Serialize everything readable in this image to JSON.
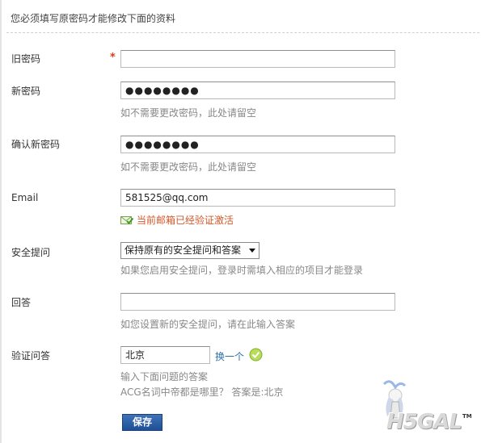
{
  "header": {
    "title": "您必须填写原密码才能修改下面的资料"
  },
  "form": {
    "old_password": {
      "label": "旧密码",
      "required_mark": "*",
      "value": ""
    },
    "new_password": {
      "label": "新密码",
      "value": "●●●●●●●●",
      "hint": "如不需要更改密码，此处请留空"
    },
    "confirm_password": {
      "label": "确认新密码",
      "value": "●●●●●●●●",
      "hint": "如不需要更改密码，此处请留空"
    },
    "email": {
      "label": "Email",
      "value": "581525@qq.com",
      "status": "当前邮箱已经验证激活"
    },
    "security_question": {
      "label": "安全提问",
      "selected": "保持原有的安全提问和答案",
      "hint": "如果您启用安全提问，登录时需填入相应的项目才能登录"
    },
    "answer": {
      "label": "回答",
      "value": "",
      "hint": "如您设置新的安全提问，请在此输入答案"
    },
    "verify": {
      "label": "验证问答",
      "value": "北京",
      "change_link": "换一个",
      "hint": "输入下面问题的答案",
      "question": "ACG名词中帝都是哪里？  答案是:北京"
    },
    "submit_label": "保存"
  },
  "watermark": {
    "text": "H5GAL",
    "tm": "TM"
  },
  "colors": {
    "required": "#e23a1e",
    "verified_text": "#d2582c",
    "link": "#2f6ea8",
    "button": "#2a5ba3"
  },
  "icons": {
    "verified": "envelope-check-icon",
    "ok": "green-check-icon",
    "dropdown": "chevron-down-icon"
  }
}
